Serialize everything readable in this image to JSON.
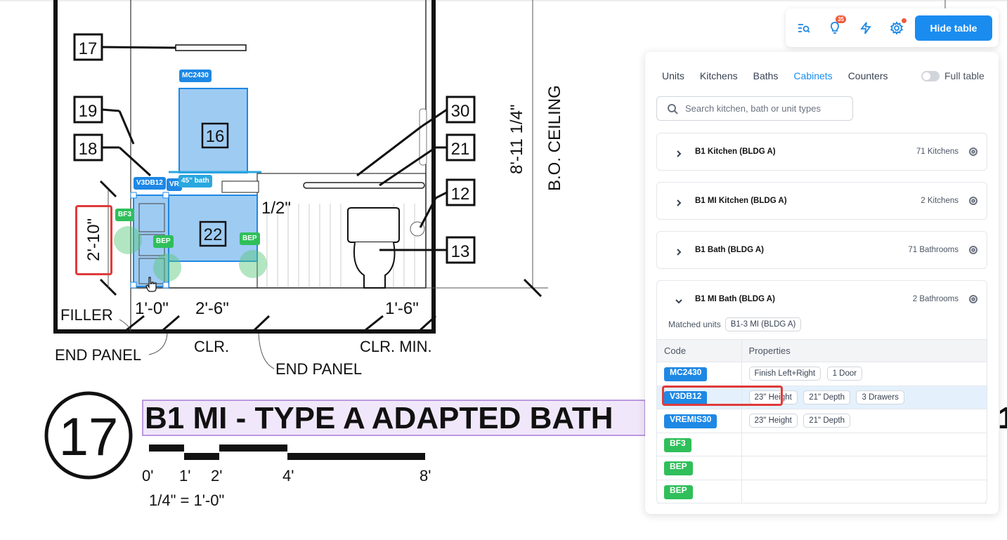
{
  "drawing": {
    "callouts": [
      "17",
      "19",
      "18",
      "16",
      "22",
      "30",
      "21",
      "12",
      "13"
    ],
    "dimensions": {
      "height_left": "2'-10\"",
      "ceiling_height": "8'-11 1/4\"",
      "ceiling_label": "B.O. CEILING",
      "half": "1/2\"",
      "w1": "1'-0\"",
      "w2": "2'-6\"",
      "w3": "1'-6\""
    },
    "labels": {
      "filler": "FILLER",
      "end_panel_left": "END PANEL",
      "clr": "CLR.",
      "end_panel_right": "END PANEL",
      "clr_min": "CLR. MIN."
    },
    "title_number": "17",
    "title": "B1 MI - TYPE A ADAPTED BATH",
    "scale_ticks": [
      "0'",
      "1'",
      "2'",
      "4'",
      "8'"
    ],
    "scale_note": "1/4\" = 1'-0\"",
    "tags": {
      "mc2430": "MC2430",
      "v3db12": "V3DB12",
      "vr": "VR",
      "bath45": "45\" bath",
      "bf3": "BF3",
      "bep1": "BEP",
      "bep2": "BEP"
    }
  },
  "toolbar": {
    "icons": [
      "search-list-icon",
      "lightbulb-icon",
      "lightning-icon",
      "gear-icon"
    ],
    "ideas_count": "35",
    "hide_table_label": "Hide table",
    "colors": {
      "accent": "#1a8cf0",
      "notify": "#f05a3a"
    }
  },
  "panel": {
    "tabs": [
      "Units",
      "Kitchens",
      "Baths",
      "Cabinets",
      "Counters"
    ],
    "active_tab": "Cabinets",
    "full_table_label": "Full table",
    "search_placeholder": "Search kitchen, bath or unit types",
    "groups": [
      {
        "title": "B1 Kitchen (BLDG A)",
        "count": "71 Kitchens",
        "expanded": false
      },
      {
        "title": "B1 MI Kitchen (BLDG A)",
        "count": "2 Kitchens",
        "expanded": false
      },
      {
        "title": "B1 Bath (BLDG A)",
        "count": "71 Bathrooms",
        "expanded": false
      },
      {
        "title": "B1 MI Bath (BLDG A)",
        "count": "2 Bathrooms",
        "expanded": true
      }
    ],
    "matched_units_label": "Matched units",
    "matched_unit": "B1-3 MI (BLDG A)",
    "table": {
      "headers": [
        "Code",
        "Properties"
      ],
      "rows": [
        {
          "code": "MC2430",
          "color": "blue",
          "props": [
            "Finish Left+Right",
            "1 Door"
          ]
        },
        {
          "code": "V3DB12",
          "color": "blue",
          "props": [
            "23\" Height",
            "21\" Depth",
            "3 Drawers"
          ],
          "selected": true
        },
        {
          "code": "VREMIS30",
          "color": "blue",
          "props": [
            "23\" Height",
            "21\" Depth"
          ]
        },
        {
          "code": "BF3",
          "color": "green",
          "props": []
        },
        {
          "code": "BEP",
          "color": "green",
          "props": []
        },
        {
          "code": "BEP",
          "color": "green",
          "props": []
        }
      ]
    }
  }
}
